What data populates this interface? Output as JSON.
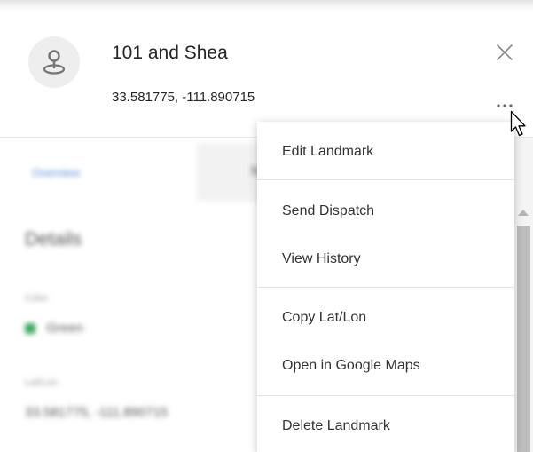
{
  "landmark": {
    "name": "101 and Shea",
    "coordinates": "33.581775, -111.890715",
    "icon": "landmark-pin-icon"
  },
  "header_actions": {
    "close_icon": "close-icon",
    "more_icon": "more-horizontal-icon"
  },
  "background_panel": {
    "tabs": [
      {
        "label": "Overview",
        "active": true
      },
      {
        "label": "N",
        "active": false
      }
    ],
    "details_heading": "Details",
    "color_label": "Color",
    "color_value": "Green",
    "color_swatch": "#3aa55a",
    "latlon_label": "Lat/Lon",
    "latlon_value": "33.581775, -111.890715"
  },
  "context_menu": {
    "groups": [
      [
        {
          "label": "Edit Landmark"
        }
      ],
      [
        {
          "label": "Send Dispatch"
        },
        {
          "label": "View History"
        }
      ],
      [
        {
          "label": "Copy Lat/Lon"
        },
        {
          "label": "Open in Google Maps"
        }
      ],
      [
        {
          "label": "Delete Landmark"
        }
      ]
    ]
  },
  "colors": {
    "accent": "#5b8fd6",
    "text": "#262626",
    "divider": "#e6e6e6"
  }
}
